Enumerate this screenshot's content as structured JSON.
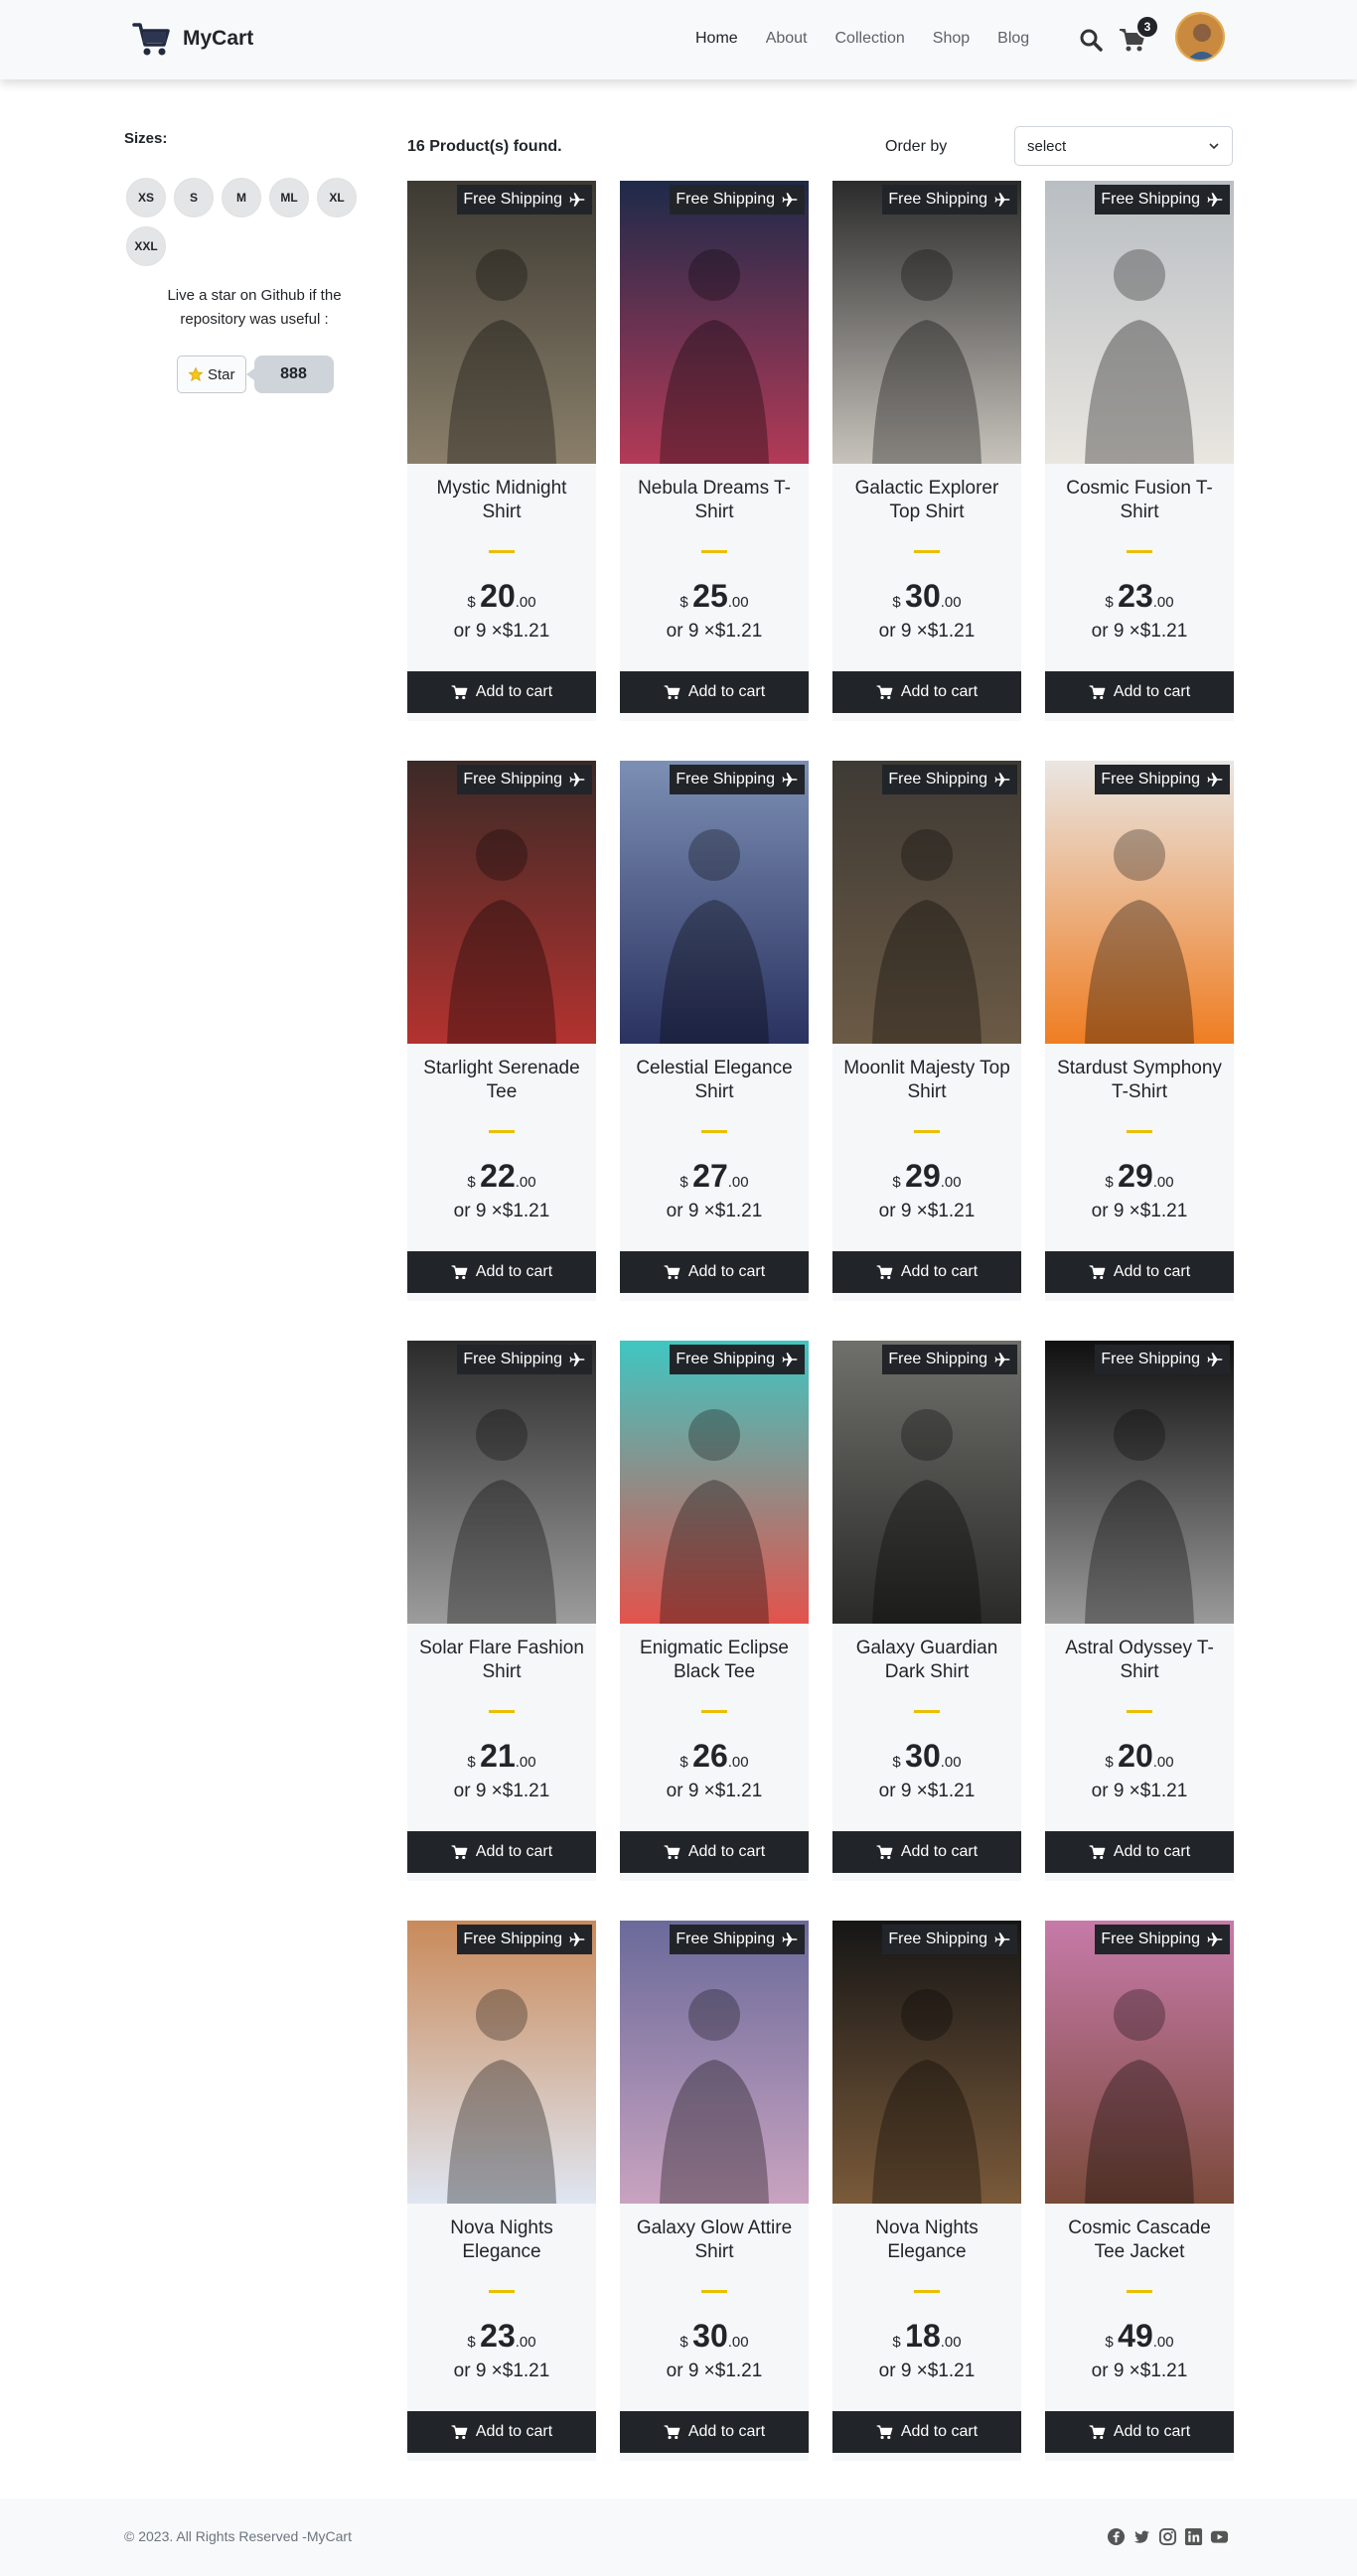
{
  "brand": {
    "name": "MyCart"
  },
  "nav": [
    {
      "label": "Home",
      "active": true
    },
    {
      "label": "About"
    },
    {
      "label": "Collection"
    },
    {
      "label": "Shop"
    },
    {
      "label": "Blog"
    }
  ],
  "cart": {
    "count": "3"
  },
  "sidebar": {
    "sizes_title": "Sizes:",
    "sizes": [
      "XS",
      "S",
      "M",
      "ML",
      "XL",
      "XXL"
    ],
    "star_text": "Live a star on Github if the repository was useful :",
    "star_label": "Star",
    "star_count": "888"
  },
  "toolbar": {
    "found": "16 Product(s) found.",
    "order_label": "Order by",
    "order_value": "select"
  },
  "product_common": {
    "ship_label": "Free Shipping",
    "currency": "$",
    "installment": "or 9 ×$1.21",
    "add_label": "Add to cart"
  },
  "products": [
    {
      "title": "Mystic Midnight Shirt",
      "price_int": "20",
      "price_dec": ".00",
      "colors": [
        "#3d3a33",
        "#8a7f6a"
      ]
    },
    {
      "title": "Nebula Dreams T-Shirt",
      "price_int": "25",
      "price_dec": ".00",
      "colors": [
        "#1e2a4a",
        "#b33a57"
      ]
    },
    {
      "title": "Galactic Explorer Top Shirt",
      "price_int": "30",
      "price_dec": ".00",
      "colors": [
        "#2b2b2b",
        "#c7c3bc"
      ]
    },
    {
      "title": "Cosmic Fusion T-Shirt",
      "price_int": "23",
      "price_dec": ".00",
      "colors": [
        "#b9bec3",
        "#e9e6e0"
      ]
    },
    {
      "title": "Starlight Serenade Tee",
      "price_int": "22",
      "price_dec": ".00",
      "colors": [
        "#3b2a27",
        "#b3322f"
      ]
    },
    {
      "title": "Celestial Elegance Shirt",
      "price_int": "27",
      "price_dec": ".00",
      "colors": [
        "#7c8fb4",
        "#2a3260"
      ]
    },
    {
      "title": "Moonlit Majesty Top Shirt",
      "price_int": "29",
      "price_dec": ".00",
      "colors": [
        "#3e3a35",
        "#6b5a45"
      ]
    },
    {
      "title": "Stardust Symphony T-Shirt",
      "price_int": "29",
      "price_dec": ".00",
      "colors": [
        "#e9e6e3",
        "#ef7d22"
      ]
    },
    {
      "title": "Solar Flare Fashion Shirt",
      "price_int": "21",
      "price_dec": ".00",
      "colors": [
        "#2b2b2b",
        "#9c9c9c"
      ]
    },
    {
      "title": "Enigmatic Eclipse Black Tee",
      "price_int": "26",
      "price_dec": ".00",
      "colors": [
        "#3fc6c2",
        "#e2534c"
      ]
    },
    {
      "title": "Galaxy Guardian Dark Shirt",
      "price_int": "30",
      "price_dec": ".00",
      "colors": [
        "#6f6f6b",
        "#2a2a28"
      ]
    },
    {
      "title": "Astral Odyssey T-Shirt",
      "price_int": "20",
      "price_dec": ".00",
      "colors": [
        "#101010",
        "#9a9a9a"
      ]
    },
    {
      "title": "Nova Nights Elegance",
      "price_int": "23",
      "price_dec": ".00",
      "colors": [
        "#c98a5a",
        "#dfe6f2"
      ]
    },
    {
      "title": "Galaxy Glow Attire Shirt",
      "price_int": "30",
      "price_dec": ".00",
      "colors": [
        "#6a6a9a",
        "#c9a3c0"
      ]
    },
    {
      "title": "Nova Nights Elegance",
      "price_int": "18",
      "price_dec": ".00",
      "colors": [
        "#161616",
        "#7a5a3a"
      ]
    },
    {
      "title": "Cosmic Cascade Tee Jacket",
      "price_int": "49",
      "price_dec": ".00",
      "colors": [
        "#c77aa9",
        "#7a4a3a"
      ]
    }
  ],
  "footer": {
    "copyright": "© 2023. All Rights Reserved -MyCart",
    "socials": [
      "facebook-icon",
      "twitter-icon",
      "instagram-icon",
      "linkedin-icon",
      "youtube-icon"
    ]
  }
}
